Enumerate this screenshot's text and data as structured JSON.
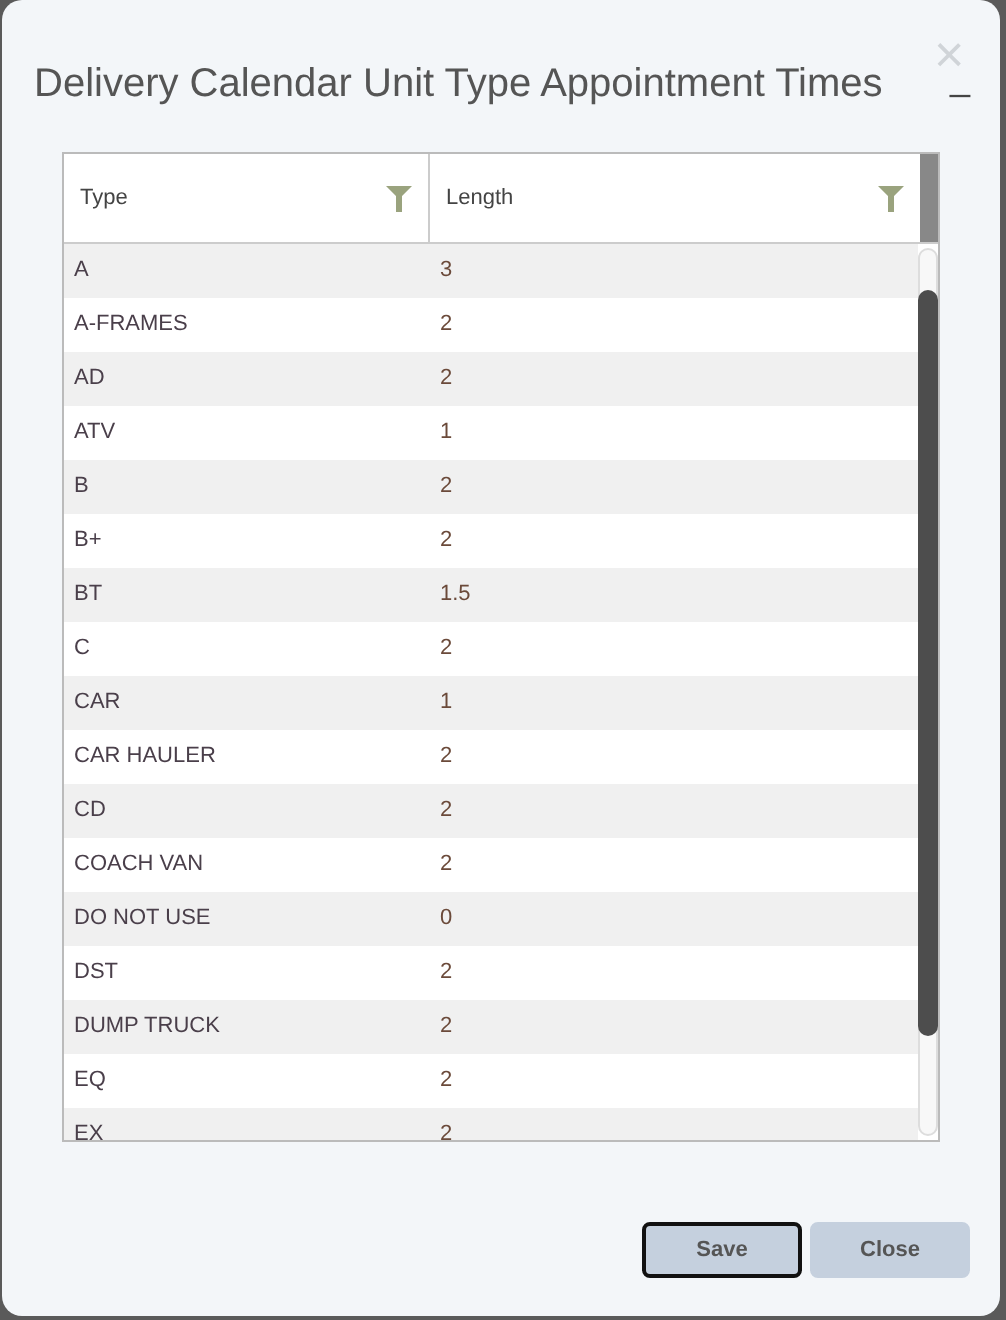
{
  "dialog": {
    "title": "Delivery Calendar Unit Type Appointment Times",
    "close_icon": "×",
    "minimize_icon": "_"
  },
  "table": {
    "columns": [
      "Type",
      "Length"
    ],
    "rows": [
      [
        "A",
        "3"
      ],
      [
        "A-FRAMES",
        "2"
      ],
      [
        "AD",
        "2"
      ],
      [
        "ATV",
        "1"
      ],
      [
        "B",
        "2"
      ],
      [
        "B+",
        "2"
      ],
      [
        "BT",
        "1.5"
      ],
      [
        "C",
        "2"
      ],
      [
        "CAR",
        "1"
      ],
      [
        "CAR HAULER",
        "2"
      ],
      [
        "CD",
        "2"
      ],
      [
        "COACH VAN",
        "2"
      ],
      [
        "DO NOT USE",
        "0"
      ],
      [
        "DST",
        "2"
      ],
      [
        "DUMP TRUCK",
        "2"
      ],
      [
        "EQ",
        "2"
      ],
      [
        "EX",
        "2"
      ]
    ]
  },
  "buttons": [
    {
      "label": "Save",
      "focused": true
    },
    {
      "label": "Close",
      "focused": false
    }
  ]
}
